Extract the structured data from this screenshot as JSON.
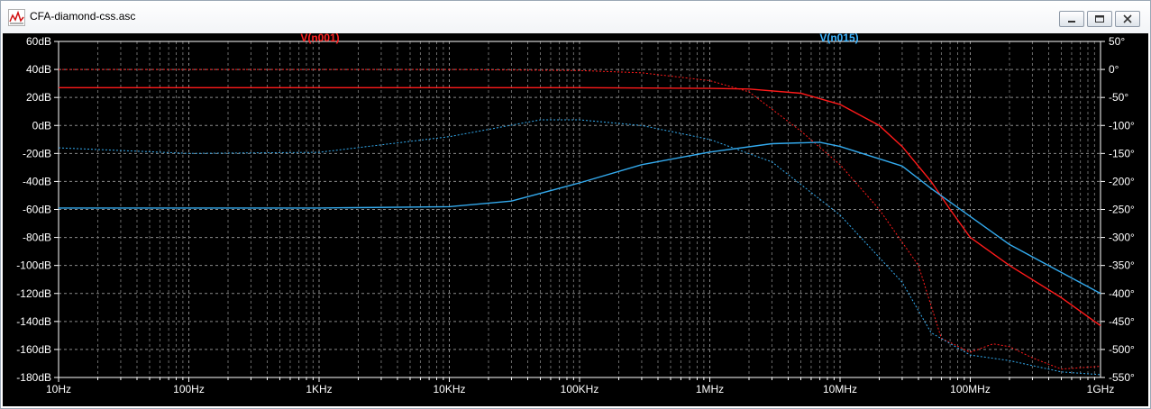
{
  "window": {
    "title": "CFA-diamond-css.asc",
    "minimize_icon": "minimize-icon",
    "restore_icon": "restore-icon",
    "close_icon": "close-icon"
  },
  "chart_data": {
    "type": "line",
    "title": "",
    "xscale": "log",
    "x_range": [
      10,
      1000000000
    ],
    "x_ticks": [
      "10Hz",
      "100Hz",
      "1KHz",
      "10KHz",
      "100KHz",
      "1MHz",
      "10MHz",
      "100MHz",
      "1GHz"
    ],
    "y_left_range": [
      -180,
      60
    ],
    "y_left_ticks": [
      "60dB",
      "40dB",
      "20dB",
      "0dB",
      "-20dB",
      "-40dB",
      "-60dB",
      "-80dB",
      "-100dB",
      "-120dB",
      "-140dB",
      "-160dB",
      "-180dB"
    ],
    "y_right_range": [
      -550,
      50
    ],
    "y_right_ticks": [
      "50°",
      "0°",
      "-50°",
      "-100°",
      "-150°",
      "-200°",
      "-250°",
      "-300°",
      "-350°",
      "-400°",
      "-450°",
      "-500°",
      "-550°"
    ],
    "grid": true,
    "background": "#000000",
    "series": [
      {
        "name": "V(n001)",
        "color": "#ff1a1a",
        "label_color": "#ff2020",
        "magnitude_db": [
          [
            10,
            27
          ],
          [
            100,
            27
          ],
          [
            1000,
            27
          ],
          [
            10000,
            27
          ],
          [
            100000,
            27
          ],
          [
            1000000,
            26.5
          ],
          [
            2000000,
            26
          ],
          [
            5000000,
            23
          ],
          [
            10000000,
            15
          ],
          [
            20000000,
            0
          ],
          [
            30000000,
            -15
          ],
          [
            50000000,
            -40
          ],
          [
            70000000,
            -60
          ],
          [
            100000000,
            -80
          ],
          [
            200000000,
            -100
          ],
          [
            500000000,
            -123
          ],
          [
            1000000000,
            -143
          ]
        ],
        "phase_deg": [
          [
            10,
            0
          ],
          [
            100,
            0
          ],
          [
            1000,
            0
          ],
          [
            10000,
            0
          ],
          [
            100000,
            -2
          ],
          [
            300000,
            -6
          ],
          [
            1000000,
            -20
          ],
          [
            2000000,
            -40
          ],
          [
            5000000,
            -110
          ],
          [
            10000000,
            -170
          ],
          [
            20000000,
            -250
          ],
          [
            40000000,
            -350
          ],
          [
            60000000,
            -480
          ],
          [
            100000000,
            -505
          ],
          [
            150000000,
            -490
          ],
          [
            200000000,
            -495
          ],
          [
            300000000,
            -515
          ],
          [
            500000000,
            -535
          ],
          [
            1000000000,
            -530
          ]
        ]
      },
      {
        "name": "V(n015)",
        "color": "#33aaee",
        "label_color": "#3cb4ff",
        "magnitude_db": [
          [
            10,
            -59
          ],
          [
            100,
            -59
          ],
          [
            1000,
            -59
          ],
          [
            10000,
            -58
          ],
          [
            30000,
            -54
          ],
          [
            100000,
            -41
          ],
          [
            300000,
            -28
          ],
          [
            1000000,
            -19
          ],
          [
            3000000,
            -13
          ],
          [
            7000000,
            -12
          ],
          [
            10000000,
            -15
          ],
          [
            30000000,
            -29
          ],
          [
            50000000,
            -45
          ],
          [
            100000000,
            -65
          ],
          [
            200000000,
            -85
          ],
          [
            500000000,
            -105
          ],
          [
            1000000000,
            -120
          ]
        ],
        "phase_deg": [
          [
            10,
            -140
          ],
          [
            100,
            -150
          ],
          [
            1000,
            -148
          ],
          [
            10000,
            -120
          ],
          [
            50000,
            -90
          ],
          [
            100000,
            -90
          ],
          [
            300000,
            -100
          ],
          [
            1000000,
            -125
          ],
          [
            3000000,
            -165
          ],
          [
            10000000,
            -260
          ],
          [
            30000000,
            -380
          ],
          [
            50000000,
            -470
          ],
          [
            100000000,
            -510
          ],
          [
            200000000,
            -520
          ],
          [
            500000000,
            -540
          ],
          [
            1000000000,
            -545
          ]
        ]
      }
    ]
  }
}
